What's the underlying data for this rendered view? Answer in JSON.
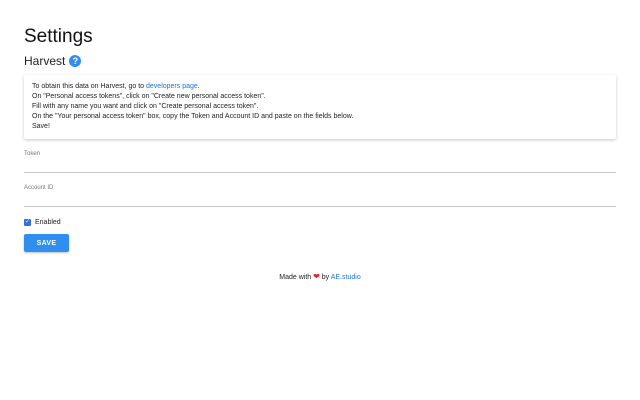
{
  "page": {
    "title": "Settings"
  },
  "section": {
    "title": "Harvest",
    "help_icon": "question-mark-icon",
    "help_glyph": "?"
  },
  "info": {
    "line1_prefix": "To obtain this data on Harvest, go to ",
    "line1_link": "developers page",
    "line1_suffix": ".",
    "line2": "On \"Personal access tokens\", click on \"Create new personal access token\".",
    "line3": "Fill with any name you want and click on \"Create personal access token\".",
    "line4": "On the \"Your personal access token\" box, copy the Token and Account ID and paste on the fields below.",
    "line5": "Save!"
  },
  "fields": {
    "token_label": "Token",
    "token_value": "",
    "account_label": "Account ID",
    "account_value": ""
  },
  "enabled": {
    "label": "Enabled",
    "checked": true,
    "check_glyph": "✓"
  },
  "actions": {
    "save_label": "SAVE"
  },
  "footer": {
    "prefix": "Made with ",
    "heart_glyph": "❤",
    "middle": " by ",
    "link": "AE.studio"
  },
  "colors": {
    "accent": "#2f8ff0",
    "link": "#1a73d6",
    "heart": "#e02424"
  }
}
